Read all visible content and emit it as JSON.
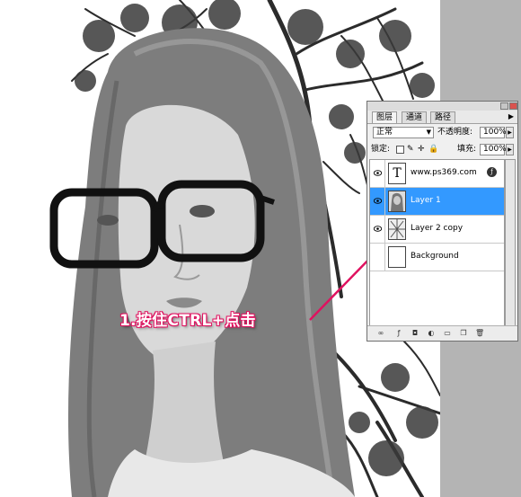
{
  "panel": {
    "tabs": [
      "图层",
      "通道",
      "路径"
    ],
    "blend_mode": "正常",
    "opacity_label": "不透明度:",
    "opacity_value": "100%",
    "lock_label": "锁定:",
    "fill_label": "填充:",
    "fill_value": "100%",
    "layers": [
      {
        "name": "www.ps369.com",
        "type": "text",
        "thumb_glyph": "T",
        "visible": true,
        "selected": false,
        "fx": true
      },
      {
        "name": "Layer 1",
        "type": "image",
        "visible": true,
        "selected": true,
        "fx": false
      },
      {
        "name": "Layer 2 copy",
        "type": "image",
        "visible": true,
        "selected": false,
        "fx": false
      },
      {
        "name": "Background",
        "type": "fill",
        "visible": false,
        "selected": false,
        "fx": false
      }
    ]
  },
  "annotation": {
    "text": "1.按住CTRL+点击",
    "color": "#e0115f"
  },
  "colors": {
    "selection": "#3399ff",
    "workspace_gray": "#b4b4b4"
  }
}
